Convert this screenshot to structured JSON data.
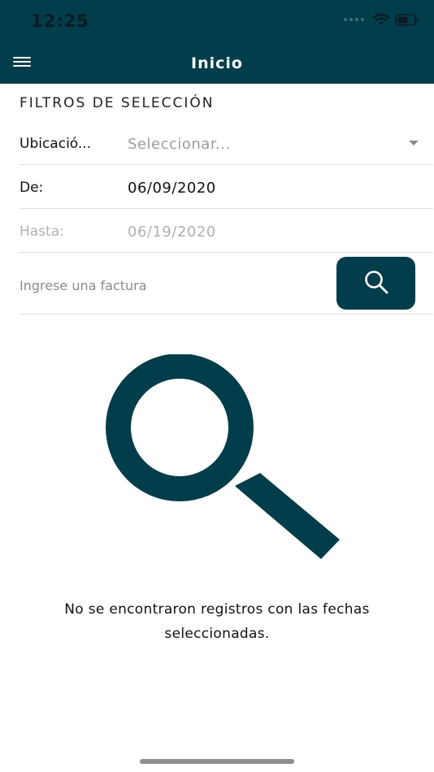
{
  "status_bar": {
    "time": "12:25"
  },
  "header": {
    "title": "Inicio"
  },
  "filters": {
    "section_title": "FILTROS DE SELECCIÓN",
    "location": {
      "label": "Ubicació...",
      "placeholder": "Seleccionar..."
    },
    "from": {
      "label": "De:",
      "value": "06/09/2020"
    },
    "to": {
      "label": "Hasta:",
      "value": "06/19/2020"
    },
    "invoice": {
      "placeholder": "Ingrese una factura"
    }
  },
  "empty_state": {
    "message": "No se encontraron registros con las fechas seleccionadas."
  },
  "colors": {
    "primary": "#013d4b",
    "muted": "#b0b0b0"
  },
  "icons": {
    "menu": "hamburger-icon",
    "search": "magnifier-icon",
    "dropdown": "triangle-down-icon"
  }
}
